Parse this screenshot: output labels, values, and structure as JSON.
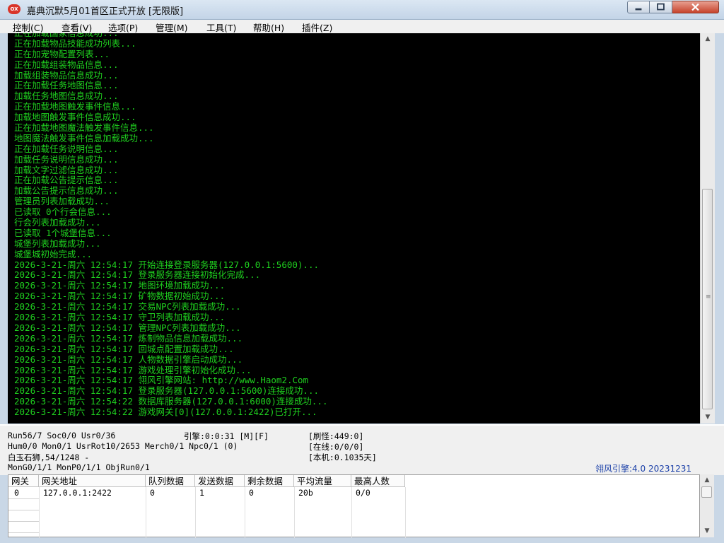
{
  "window": {
    "title": "嘉典沉默5月01首区正式开放 [无限版]",
    "app_icon_label": "OX",
    "accent_close_color": "#c7432c"
  },
  "menu": [
    {
      "label": "控制(C)"
    },
    {
      "label": "查看(V)"
    },
    {
      "label": "选项(P)"
    },
    {
      "label": "管理(M)"
    },
    {
      "label": "工具(T)"
    },
    {
      "label": "帮助(H)"
    },
    {
      "label": "插件(Z)"
    }
  ],
  "log": {
    "text_color": "#1fd01f",
    "lines": [
      "正在加载国家信息成功...",
      "正在加载物品技能成功列表...",
      "正在加宠物配置列表...",
      "正在加载组装物品信息...",
      "加载组装物品信息成功...",
      "正在加载任务地图信息...",
      "加载任务地图信息成功...",
      "正在加载地图触发事件信息...",
      "加载地图触发事件信息成功...",
      "正在加载地图魔法触发事件信息...",
      "地图魔法触发事件信息加载成功...",
      "正在加载任务说明信息...",
      "加载任务说明信息成功...",
      "加载文字过滤信息成功...",
      "正在加载公告提示信息...",
      "加载公告提示信息成功...",
      "管理员列表加载成功...",
      "已读取 0个行会信息...",
      "行会列表加载成功...",
      "已读取 1个城堡信息...",
      "城堡列表加载成功...",
      "城堡城初始完成...",
      "2026-3-21-周六 12:54:17 开始连接登录服务器(127.0.0.1:5600)...",
      "2026-3-21-周六 12:54:17 登录服务器连接初始化完成...",
      "2026-3-21-周六 12:54:17 地图环境加载成功...",
      "2026-3-21-周六 12:54:17 矿物数据初始成功...",
      "2026-3-21-周六 12:54:17 交易NPC列表加载成功...",
      "2026-3-21-周六 12:54:17 守卫列表加载成功...",
      "2026-3-21-周六 12:54:17 管理NPC列表加载成功...",
      "2026-3-21-周六 12:54:17 炼制物品信息加载成功...",
      "2026-3-21-周六 12:54:17 回城点配置加载成功...",
      "2026-3-21-周六 12:54:17 人物数据引擎启动成功...",
      "2026-3-21-周六 12:54:17 游戏处理引擎初始化成功...",
      "2026-3-21-周六 12:54:17 翎风引擎网站: http://www.Haom2.Com",
      "2026-3-21-周六 12:54:17 登录服务器(127.0.0.1:5600)连接成功...",
      "2026-3-21-周六 12:54:22 数据库服务器(127.0.0.1:6000)连接成功...",
      "2026-3-21-周六 12:54:22 游戏网关[0](127.0.0.1:2422)已打开..."
    ]
  },
  "status": {
    "run": "Run56/7 Soc0/0 Usr0/36",
    "engine": "引擎:0:0:31 [M][F]",
    "refresh": "[刷怪:449:0]",
    "hum": "Hum0/0 Mon0/1 UsrRot10/2653 Merch0/1 Npc0/1 (0)",
    "online": "[在线:0/0/0]",
    "location": "白玉石狮,54/1248 -",
    "local": "[本机:0.1035天]",
    "mongo": "MonG0/1/1 MonP0/1/1 ObjRun0/1",
    "engine_version": "翎风引擎:4.0 20231231",
    "engine_version_color": "#1a3fa8"
  },
  "gateway_table": {
    "headers": [
      "网关",
      "网关地址",
      "队列数据",
      "发送数据",
      "剩余数据",
      "平均流量",
      "最高人数"
    ],
    "rows": [
      [
        "0",
        "127.0.0.1:2422",
        "0",
        "1",
        "0",
        "20b",
        "0/0"
      ]
    ]
  }
}
